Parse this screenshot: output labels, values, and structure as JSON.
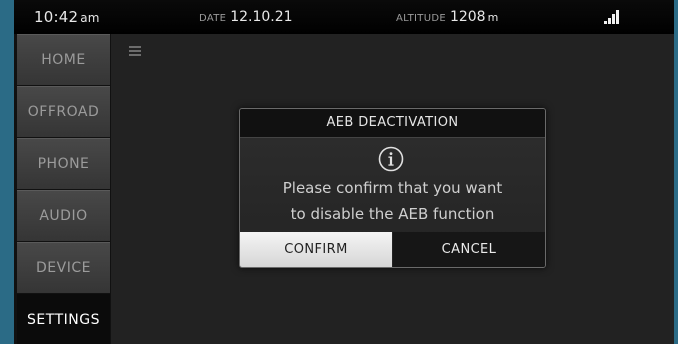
{
  "status_bar": {
    "time": "10:42",
    "ampm": "am",
    "date_label": "DATE",
    "date_value": "12.10.21",
    "altitude_label": "ALTITUDE",
    "altitude_value": "1208",
    "altitude_unit": "m",
    "signal_icon": "signal-strength-icon"
  },
  "sidebar": {
    "items": [
      {
        "label": "HOME",
        "active": false
      },
      {
        "label": "OFFROAD",
        "active": false
      },
      {
        "label": "PHONE",
        "active": false
      },
      {
        "label": "AUDIO",
        "active": false
      },
      {
        "label": "DEVICE",
        "active": false
      },
      {
        "label": "SETTINGS",
        "active": true
      }
    ]
  },
  "main": {
    "menu_icon": "hamburger-menu-icon"
  },
  "dialog": {
    "title": "AEB DEACTIVATION",
    "icon": "info-icon",
    "message_line1": "Please confirm that you want",
    "message_line2": "to disable the AEB function",
    "confirm_label": "CONFIRM",
    "cancel_label": "CANCEL"
  },
  "colors": {
    "frame_accent": "#2b6b86",
    "confirm_bg": "#e6e6e6",
    "cancel_bg": "#161616"
  }
}
